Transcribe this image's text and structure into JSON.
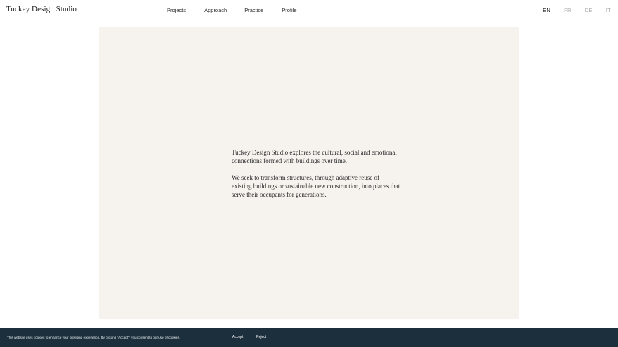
{
  "header": {
    "logo": "Tuckey Design Studio",
    "nav": [
      "Projects",
      "Approach",
      "Practice",
      "Profile"
    ],
    "languages": [
      "EN",
      "FR",
      "DE",
      "IT"
    ],
    "active_language": "EN"
  },
  "hero": {
    "paragraphs": [
      "Tuckey Design Studio explores the cultural, social and emotional connections formed with buildings over time.",
      "We seek to transform structures, through adaptive reuse of existing buildings or sustainable new construction, into places that serve their occupants for generations."
    ]
  },
  "cookie_banner": {
    "text": "This website uses cookies to enhance your browsing experience. By clicking “Accept”, you consent to our use of cookies.",
    "accept_label": "Accept",
    "reject_label": "Reject"
  },
  "colors": {
    "hero_background": "#f6f3ee",
    "cookie_banner_background": "#1b2f3c"
  }
}
